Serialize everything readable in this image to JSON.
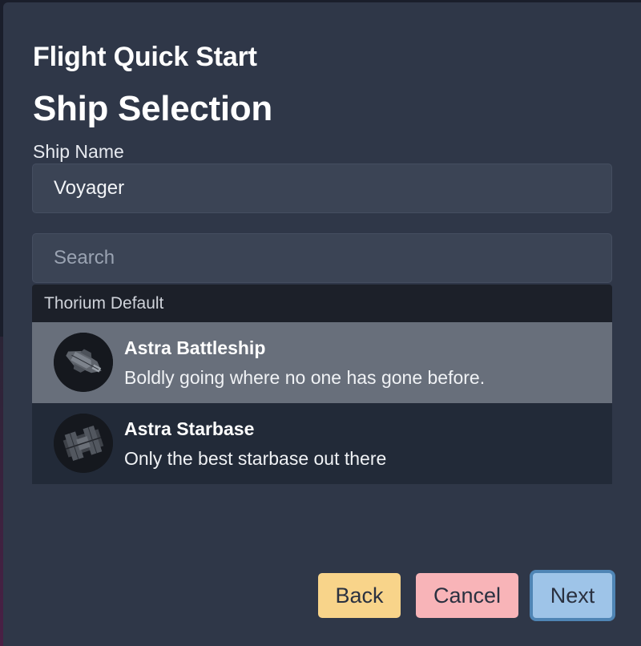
{
  "dialog": {
    "eyebrow": "Flight Quick Start",
    "title": "Ship Selection"
  },
  "ship_name": {
    "label": "Ship Name",
    "value": "Voyager"
  },
  "search": {
    "placeholder": "Search"
  },
  "ship_list": {
    "group_label": "Thorium Default",
    "items": [
      {
        "name": "Astra Battleship",
        "description": "Boldly going where no one has gone before.",
        "selected": true,
        "icon": "battleship-thumbnail-icon"
      },
      {
        "name": "Astra Starbase",
        "description": "Only the best starbase out there",
        "selected": false,
        "icon": "starbase-thumbnail-icon"
      }
    ]
  },
  "footer": {
    "back_label": "Back",
    "cancel_label": "Cancel",
    "next_label": "Next"
  },
  "colors": {
    "dialog_background": "#2f3748",
    "selected_item": "#686f7b",
    "back_button": "#f8d48a",
    "cancel_button": "#f8b4b8",
    "next_button": "#9ec4e8",
    "next_button_border": "#4f85b5"
  }
}
